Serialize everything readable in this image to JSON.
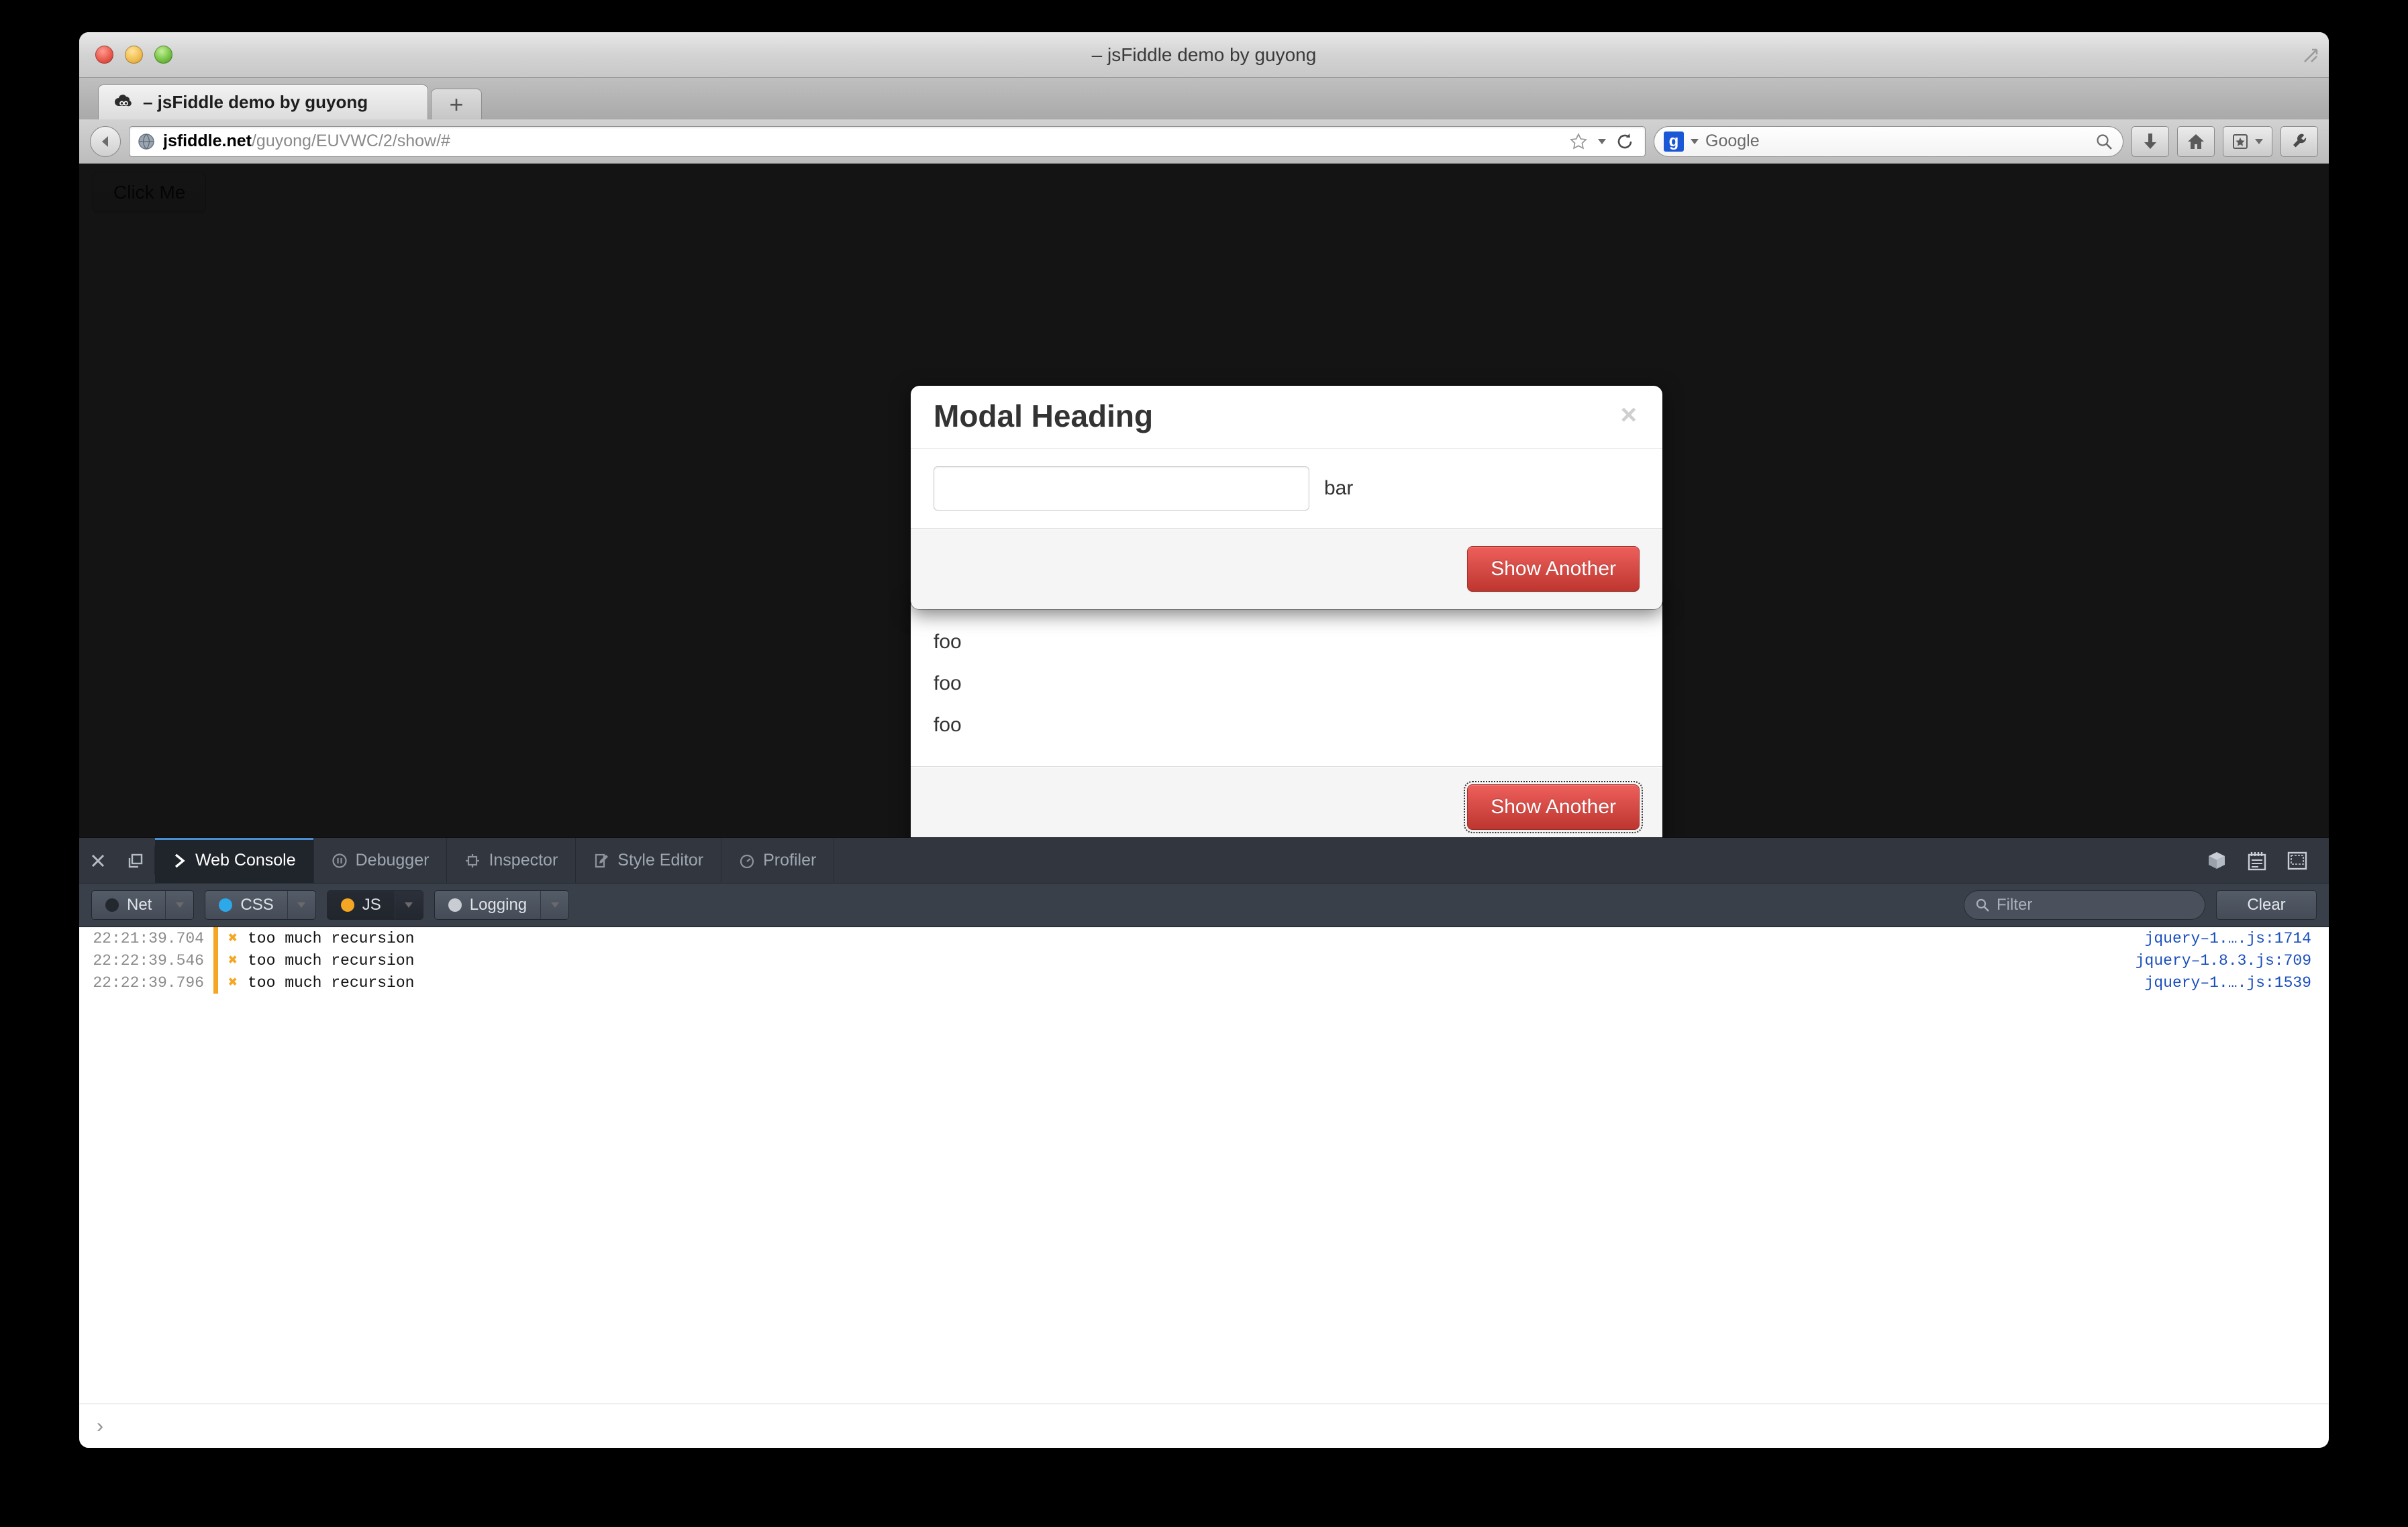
{
  "window": {
    "title": "– jsFiddle demo by guyong",
    "traffic_lights": [
      "close",
      "minimize",
      "zoom"
    ]
  },
  "tabs": [
    {
      "title": "– jsFiddle demo by guyong",
      "favicon": "jsfiddle-icon",
      "active": true
    }
  ],
  "new_tab_label": "+",
  "navbar": {
    "back_icon": "back-arrow-icon",
    "site_icon": "globe-icon",
    "url_host": "jsfiddle.net",
    "url_path": "/guyong/EUVWC/2/show/#",
    "bookmark_icon": "star-icon",
    "reload_icon": "reload-icon",
    "search": {
      "engine": "Google",
      "engine_badge": "g",
      "placeholder": "Google",
      "search_icon": "magnifier-icon"
    },
    "buttons": [
      {
        "name": "downloads-button",
        "icon": "download-arrow-icon"
      },
      {
        "name": "home-button",
        "icon": "home-icon"
      },
      {
        "name": "bookmarks-button",
        "icon": "bookmarks-star-icon"
      },
      {
        "name": "customize-button",
        "icon": "wrench-icon"
      }
    ]
  },
  "page": {
    "click_me_label": "Click Me"
  },
  "modal_1": {
    "title": "Modal Heading",
    "close_label": "×",
    "input_value": "",
    "input_placeholder": "",
    "field_label": "bar",
    "footer_button": "Show Another"
  },
  "modal_2": {
    "items": [
      "foo",
      "foo",
      "foo"
    ],
    "footer_button": "Show Another"
  },
  "devtools": {
    "close_icon": "close-icon",
    "undock_icon": "undock-window-icon",
    "tabs": [
      {
        "label": "Web Console",
        "icon": "chevron-right-icon",
        "active": true
      },
      {
        "label": "Debugger",
        "icon": "pause-circle-icon",
        "active": false
      },
      {
        "label": "Inspector",
        "icon": "inspect-box-icon",
        "active": false
      },
      {
        "label": "Style Editor",
        "icon": "style-pen-icon",
        "active": false
      },
      {
        "label": "Profiler",
        "icon": "stopwatch-icon",
        "active": false
      }
    ],
    "right_icons": [
      {
        "name": "toolbox-cube-icon"
      },
      {
        "name": "scratchpad-icon"
      },
      {
        "name": "responsive-design-icon"
      }
    ],
    "filters": [
      {
        "label": "Net",
        "dot_color": "#23272e",
        "active": false
      },
      {
        "label": "CSS",
        "dot_color": "#2da8e8",
        "active": false
      },
      {
        "label": "JS",
        "dot_color": "#f5a623",
        "active": true
      },
      {
        "label": "Logging",
        "dot_color": "#c9cdd3",
        "active": false
      }
    ],
    "filter_input": {
      "placeholder": "Filter",
      "value": "",
      "icon": "magnifier-icon"
    },
    "clear_button": "Clear",
    "log_entries": [
      {
        "time": "22:21:39.704",
        "icon": "error-x-icon",
        "message": "too much recursion",
        "source": "jquery–1.….js:1714"
      },
      {
        "time": "22:22:39.546",
        "icon": "error-x-icon",
        "message": "too much recursion",
        "source": "jquery–1.8.3.js:709"
      },
      {
        "time": "22:22:39.796",
        "icon": "error-x-icon",
        "message": "too much recursion",
        "source": "jquery–1.….js:1539"
      }
    ],
    "prompt_chevron": "›"
  }
}
